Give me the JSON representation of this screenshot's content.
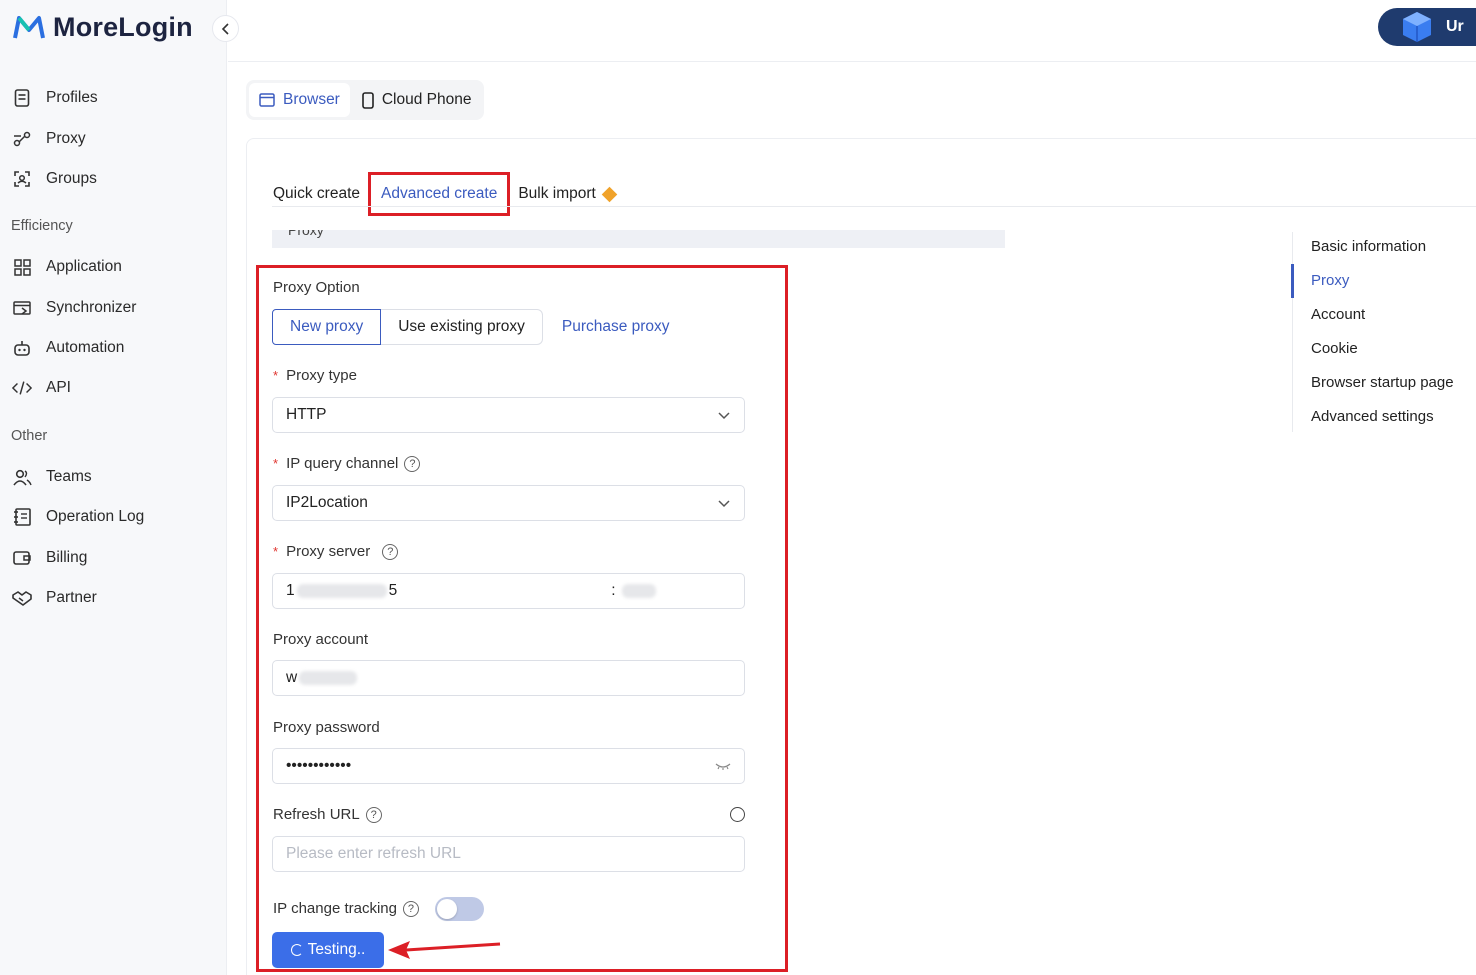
{
  "brand": {
    "name": "MoreLogin"
  },
  "sidebar": {
    "collapse_icon": "chevron-left-icon",
    "main_items": [
      {
        "label": "Profiles",
        "icon": "document-icon"
      },
      {
        "label": "Proxy",
        "icon": "proxy-icon"
      },
      {
        "label": "Groups",
        "icon": "groups-icon"
      }
    ],
    "efficiency_title": "Efficiency",
    "efficiency_items": [
      {
        "label": "Application",
        "icon": "grid-icon"
      },
      {
        "label": "Synchronizer",
        "icon": "sync-icon"
      },
      {
        "label": "Automation",
        "icon": "robot-icon"
      },
      {
        "label": "API",
        "icon": "code-icon"
      }
    ],
    "other_title": "Other",
    "other_items": [
      {
        "label": "Teams",
        "icon": "users-icon"
      },
      {
        "label": "Operation Log",
        "icon": "log-icon"
      },
      {
        "label": "Billing",
        "icon": "wallet-icon"
      },
      {
        "label": "Partner",
        "icon": "handshake-icon"
      }
    ]
  },
  "topbar": {
    "promo_text": "Ur"
  },
  "device_tabs": [
    {
      "label": "Browser",
      "icon": "browser-icon",
      "active": true
    },
    {
      "label": "Cloud Phone",
      "icon": "phone-icon",
      "active": false
    }
  ],
  "create_tabs": {
    "quick": "Quick create",
    "advanced": "Advanced create",
    "bulk": "Bulk import"
  },
  "section_header": "Proxy",
  "form": {
    "proxy_option_label": "Proxy Option",
    "options": {
      "new": "New proxy",
      "existing": "Use existing proxy",
      "purchase": "Purchase proxy"
    },
    "proxy_type_label": "Proxy type",
    "proxy_type_value": "HTTP",
    "ip_channel_label": "IP query channel",
    "ip_channel_value": "IP2Location",
    "proxy_server_label": "Proxy server",
    "proxy_server_prefix": "1",
    "proxy_server_suffix": "5",
    "proxy_server_sep": ":",
    "proxy_account_label": "Proxy account",
    "proxy_account_prefix": "w",
    "proxy_password_label": "Proxy password",
    "proxy_password_value": "••••••••••••",
    "refresh_url_label": "Refresh URL",
    "refresh_url_placeholder": "Please enter refresh URL",
    "ip_tracking_label": "IP change tracking",
    "ip_tracking_on": false,
    "testing_label": "Testing..",
    "required_mark": "*",
    "help_glyph": "?"
  },
  "anchor_nav": [
    {
      "label": "Basic information",
      "active": false
    },
    {
      "label": "Proxy",
      "active": true
    },
    {
      "label": "Account",
      "active": false
    },
    {
      "label": "Cookie",
      "active": false
    },
    {
      "label": "Browser startup page",
      "active": false
    },
    {
      "label": "Advanced settings",
      "active": false
    }
  ],
  "colors": {
    "accent": "#3b5bbf",
    "primary_button": "#3b6ee8",
    "highlight_red": "#dc1f26",
    "brand_dark": "#1d2440"
  }
}
